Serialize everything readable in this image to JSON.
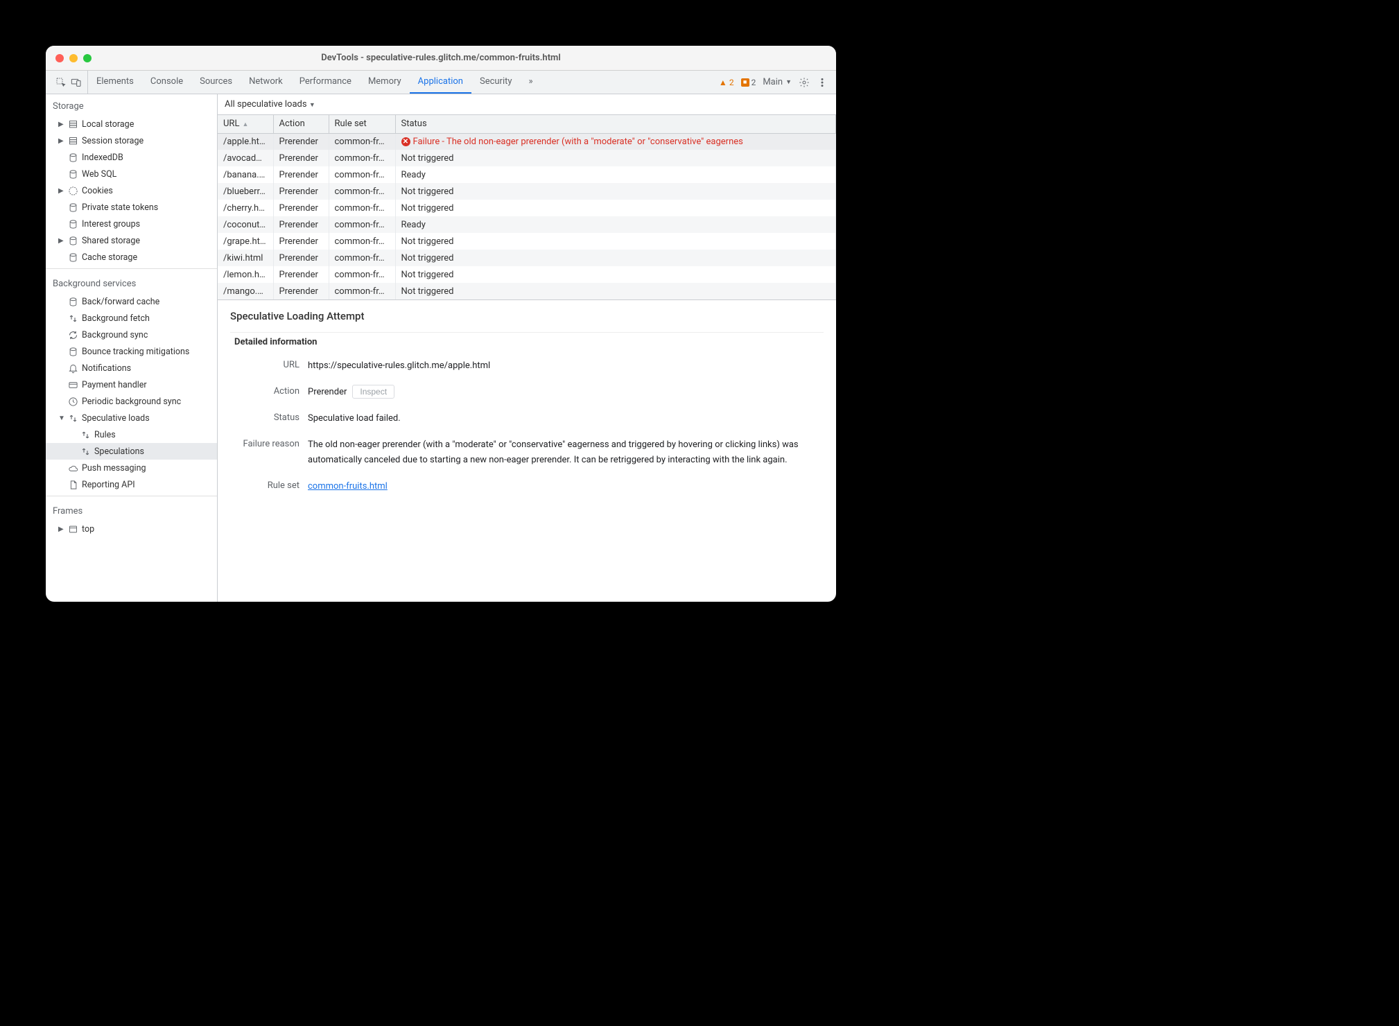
{
  "window_title": "DevTools - speculative-rules.glitch.me/common-fruits.html",
  "tabs": [
    "Elements",
    "Console",
    "Sources",
    "Network",
    "Performance",
    "Memory",
    "Application",
    "Security"
  ],
  "active_tab": "Application",
  "more_glyph": "»",
  "warn_count": "2",
  "info_count": "2",
  "context_label": "Main",
  "sidebar": {
    "storage": {
      "title": "Storage",
      "items": [
        {
          "label": "Local storage",
          "icon": "db",
          "exp": true
        },
        {
          "label": "Session storage",
          "icon": "db",
          "exp": true
        },
        {
          "label": "IndexedDB",
          "icon": "disk"
        },
        {
          "label": "Web SQL",
          "icon": "disk"
        },
        {
          "label": "Cookies",
          "icon": "cookie",
          "exp": true
        },
        {
          "label": "Private state tokens",
          "icon": "disk"
        },
        {
          "label": "Interest groups",
          "icon": "disk"
        },
        {
          "label": "Shared storage",
          "icon": "disk",
          "exp": true
        },
        {
          "label": "Cache storage",
          "icon": "disk"
        }
      ]
    },
    "background": {
      "title": "Background services",
      "items": [
        {
          "label": "Back/forward cache",
          "icon": "disk"
        },
        {
          "label": "Background fetch",
          "icon": "updown"
        },
        {
          "label": "Background sync",
          "icon": "sync"
        },
        {
          "label": "Bounce tracking mitigations",
          "icon": "disk"
        },
        {
          "label": "Notifications",
          "icon": "bell"
        },
        {
          "label": "Payment handler",
          "icon": "card"
        },
        {
          "label": "Periodic background sync",
          "icon": "clock"
        },
        {
          "label": "Speculative loads",
          "icon": "updown",
          "exp": true,
          "open": true
        },
        {
          "label": "Rules",
          "icon": "updown",
          "sub": true
        },
        {
          "label": "Speculations",
          "icon": "updown",
          "sub": true,
          "selected": true
        },
        {
          "label": "Push messaging",
          "icon": "cloud"
        },
        {
          "label": "Reporting API",
          "icon": "file"
        }
      ]
    },
    "frames": {
      "title": "Frames",
      "items": [
        {
          "label": "top",
          "icon": "frame",
          "exp": true
        }
      ]
    }
  },
  "filter_label": "All speculative loads",
  "table": {
    "columns": [
      "URL",
      "Action",
      "Rule set",
      "Status"
    ],
    "rows": [
      {
        "url": "/apple.html",
        "action": "Prerender",
        "ruleset": "common-fr…",
        "status": "Failure - The old non-eager prerender (with a \"moderate\" or \"conservative\" eagernes",
        "fail": true,
        "sel": true
      },
      {
        "url": "/avocad…",
        "action": "Prerender",
        "ruleset": "common-fr…",
        "status": "Not triggered"
      },
      {
        "url": "/banana.…",
        "action": "Prerender",
        "ruleset": "common-fr…",
        "status": "Ready"
      },
      {
        "url": "/blueberr…",
        "action": "Prerender",
        "ruleset": "common-fr…",
        "status": "Not triggered"
      },
      {
        "url": "/cherry.h…",
        "action": "Prerender",
        "ruleset": "common-fr…",
        "status": "Not triggered"
      },
      {
        "url": "/coconut…",
        "action": "Prerender",
        "ruleset": "common-fr…",
        "status": "Ready"
      },
      {
        "url": "/grape.html",
        "action": "Prerender",
        "ruleset": "common-fr…",
        "status": "Not triggered"
      },
      {
        "url": "/kiwi.html",
        "action": "Prerender",
        "ruleset": "common-fr…",
        "status": "Not triggered"
      },
      {
        "url": "/lemon.h…",
        "action": "Prerender",
        "ruleset": "common-fr…",
        "status": "Not triggered"
      },
      {
        "url": "/mango.…",
        "action": "Prerender",
        "ruleset": "common-fr…",
        "status": "Not triggered"
      }
    ]
  },
  "detail": {
    "heading": "Speculative Loading Attempt",
    "subheading": "Detailed information",
    "url_label": "URL",
    "url_value": "https://speculative-rules.glitch.me/apple.html",
    "action_label": "Action",
    "action_value": "Prerender",
    "inspect_label": "Inspect",
    "status_label": "Status",
    "status_value": "Speculative load failed.",
    "failure_label": "Failure reason",
    "failure_value": "The old non-eager prerender (with a \"moderate\" or \"conservative\" eagerness and triggered by hovering or clicking links) was automatically canceled due to starting a new non-eager prerender. It can be retriggered by interacting with the link again.",
    "ruleset_label": "Rule set",
    "ruleset_value": "common-fruits.html"
  }
}
